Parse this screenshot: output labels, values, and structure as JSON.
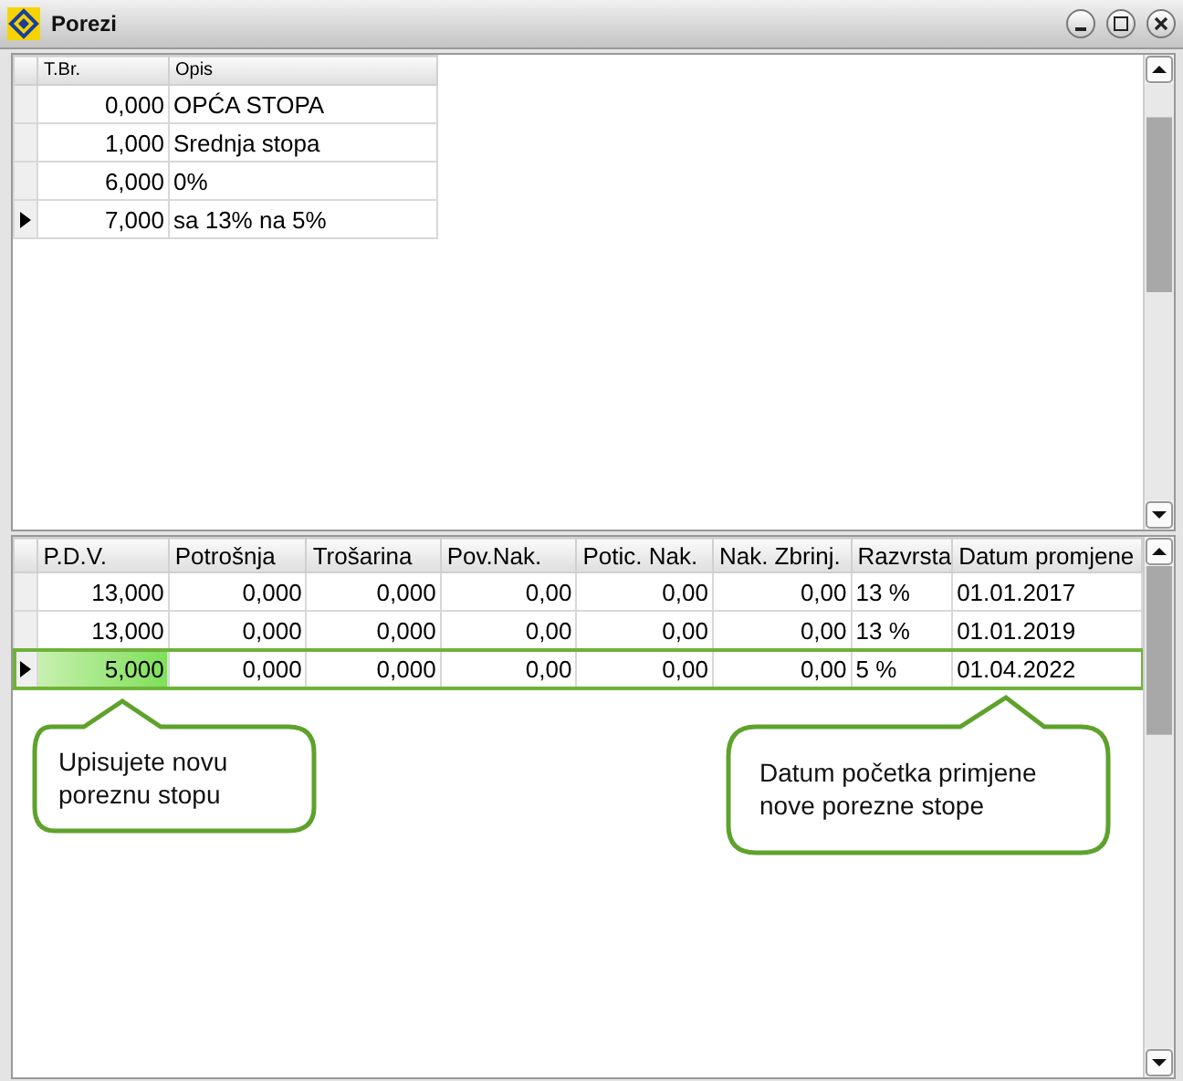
{
  "window": {
    "title": "Porezi"
  },
  "top_grid": {
    "columns": [
      "T.Br.",
      "Opis"
    ],
    "rows": [
      {
        "cells": [
          "0,000",
          "OPĆA STOPA"
        ],
        "selected": false
      },
      {
        "cells": [
          "1,000",
          "Srednja stopa"
        ],
        "selected": false
      },
      {
        "cells": [
          "6,000",
          "0%"
        ],
        "selected": false
      },
      {
        "cells": [
          "7,000",
          "sa 13% na 5%"
        ],
        "selected": true
      }
    ]
  },
  "bottom_grid": {
    "columns": [
      "P.D.V.",
      "Potrošnja",
      "Trošarina",
      "Pov.Nak.",
      "Potic. Nak.",
      "Nak. Zbrinj.",
      "Razvrsta",
      "Datum promjene"
    ],
    "rows": [
      {
        "cells": [
          "13,000",
          "0,000",
          "0,000",
          "0,00",
          "0,00",
          "0,00",
          "13 %",
          "01.01.2017"
        ],
        "selected": false
      },
      {
        "cells": [
          "13,000",
          "0,000",
          "0,000",
          "0,00",
          "0,00",
          "0,00",
          "13 %",
          "01.01.2019"
        ],
        "selected": false
      },
      {
        "cells": [
          "5,000",
          "0,000",
          "0,000",
          "0,00",
          "0,00",
          "0,00",
          "5 %",
          "01.04.2022"
        ],
        "selected": true
      }
    ]
  },
  "callouts": [
    "Upisujete novu poreznu stopu",
    "Datum početka primjene nove porezne stope"
  ]
}
